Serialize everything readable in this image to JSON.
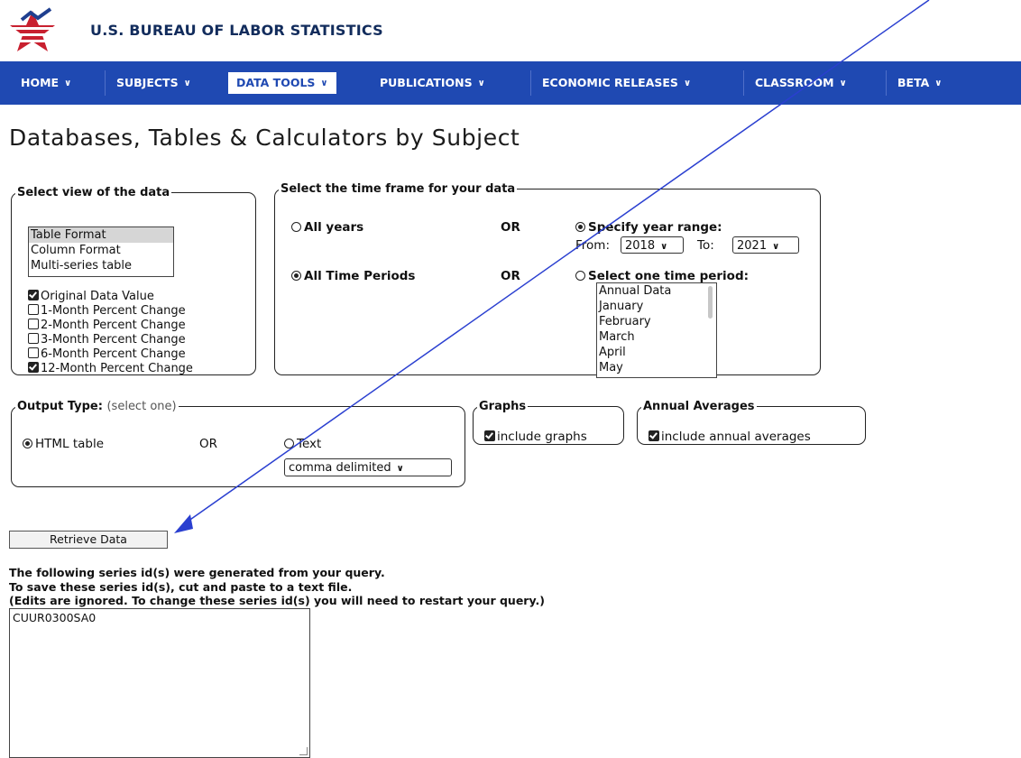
{
  "header": {
    "agency_name": "U.S. BUREAU OF LABOR STATISTICS"
  },
  "nav": {
    "items": [
      {
        "label": "HOME"
      },
      {
        "label": "SUBJECTS"
      },
      {
        "label": "DATA TOOLS"
      },
      {
        "label": "PUBLICATIONS"
      },
      {
        "label": "ECONOMIC RELEASES"
      },
      {
        "label": "CLASSROOM"
      },
      {
        "label": "BETA"
      }
    ],
    "active": "DATA TOOLS"
  },
  "page": {
    "title": "Databases, Tables & Calculators by Subject"
  },
  "view": {
    "legend": "Select view of the data",
    "formats": [
      "Table Format",
      "Column Format",
      "Multi-series table"
    ],
    "selected_format": "Table Format",
    "options": [
      {
        "label": "Original Data Value",
        "checked": true
      },
      {
        "label": "1-Month Percent Change",
        "checked": false
      },
      {
        "label": "2-Month Percent Change",
        "checked": false
      },
      {
        "label": "3-Month Percent Change",
        "checked": false
      },
      {
        "label": "6-Month Percent Change",
        "checked": false
      },
      {
        "label": "12-Month Percent Change",
        "checked": true
      }
    ]
  },
  "timeframe": {
    "legend": "Select the time frame for your data",
    "all_years": "All years",
    "or": "OR",
    "specify_range": "Specify year range:",
    "from_label": "From:",
    "from_value": "2018",
    "to_label": "To:",
    "to_value": "2021",
    "all_periods": "All Time Periods",
    "one_period": "Select one time period:",
    "periods": [
      "Annual Data",
      "January",
      "February",
      "March",
      "April",
      "May"
    ]
  },
  "output": {
    "legend": "Output Type:",
    "legend_hint": "(select one)",
    "html_table": "HTML table",
    "or": "OR",
    "text": "Text",
    "delimiter": "comma delimited"
  },
  "graphs": {
    "legend": "Graphs",
    "include_label": "include graphs"
  },
  "annual": {
    "legend": "Annual Averages",
    "include_label": "include annual averages"
  },
  "retrieve_button": "Retrieve Data",
  "series": {
    "line1": "The following series id(s) were generated from your query.",
    "line2": "To save these series id(s), cut and paste to a text file.",
    "line3": "(Edits are ignored. To change these series id(s) you will need to restart your query.)",
    "ids": "CUUR0300SA0"
  },
  "colors": {
    "nav_bg": "#1f49b2",
    "logo_red": "#c8202f",
    "logo_blue": "#1f3f8f",
    "annotation_arrow": "#2a3fd0"
  }
}
